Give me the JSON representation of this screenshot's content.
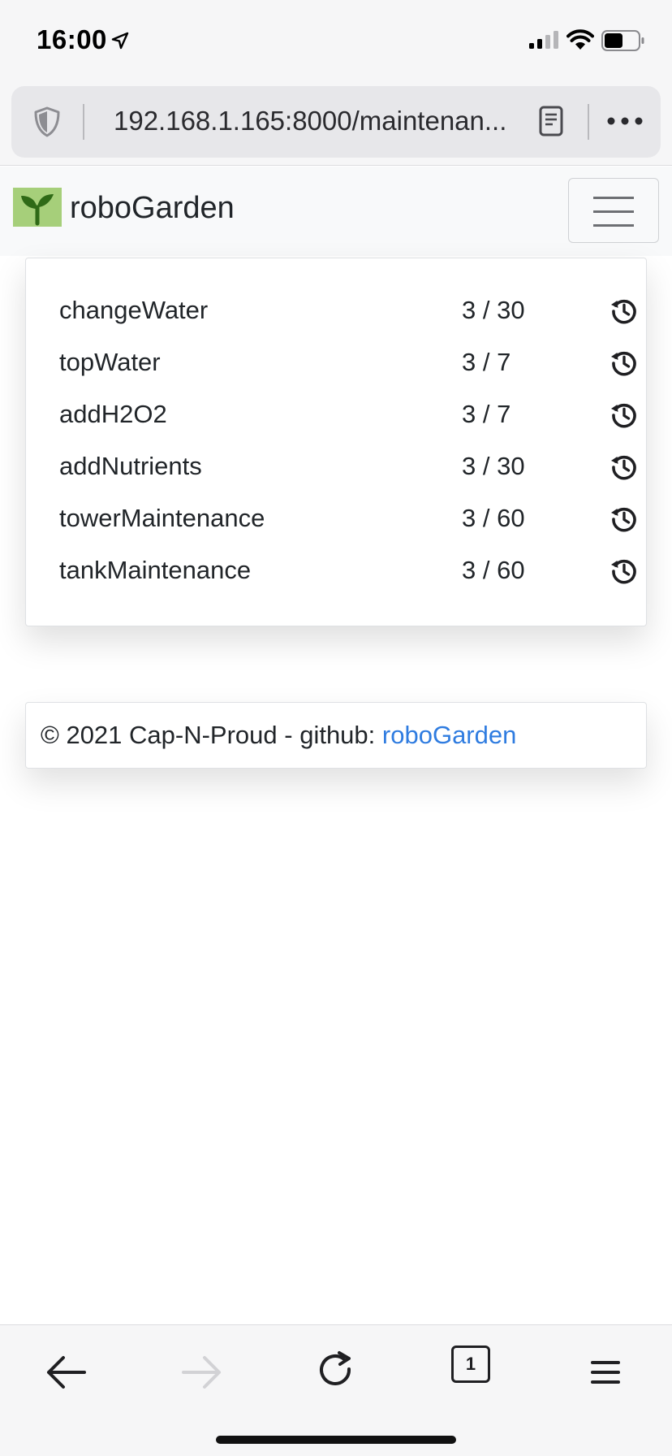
{
  "status_bar": {
    "time": "16:00",
    "icons": [
      "location-arrow-icon",
      "signal-icon",
      "wifi-icon",
      "battery-icon"
    ]
  },
  "browser": {
    "url": "192.168.1.165:8000/maintenan...",
    "icons": [
      "shield-icon",
      "reader-mode-icon",
      "more-icon"
    ]
  },
  "navbar": {
    "brand_name": "roboGarden",
    "logo_icon": "seedling-icon",
    "menu_icon": "hamburger-menu-icon"
  },
  "maintenance": {
    "tasks": [
      {
        "name": "changeWater",
        "count": "3 / 30"
      },
      {
        "name": "topWater",
        "count": "3 / 7"
      },
      {
        "name": "addH2O2",
        "count": "3 / 7"
      },
      {
        "name": "addNutrients",
        "count": "3 / 30"
      },
      {
        "name": "towerMaintenance",
        "count": "3 / 60"
      },
      {
        "name": "tankMaintenance",
        "count": "3 / 60"
      }
    ],
    "action_icon": "history-icon"
  },
  "footer": {
    "text": "© 2021 Cap-N-Proud - github: ",
    "link_text": "roboGarden",
    "link_color": "#2f7ce0"
  },
  "toolbar": {
    "tab_count": "1",
    "icons": [
      "back-arrow-icon",
      "forward-arrow-icon",
      "reload-icon",
      "tabs-icon",
      "menu-icon"
    ]
  },
  "colors": {
    "logo_green": "#a6cf7a",
    "navbar_bg": "#f8f9fa",
    "chrome_bg": "#f6f6f7"
  }
}
